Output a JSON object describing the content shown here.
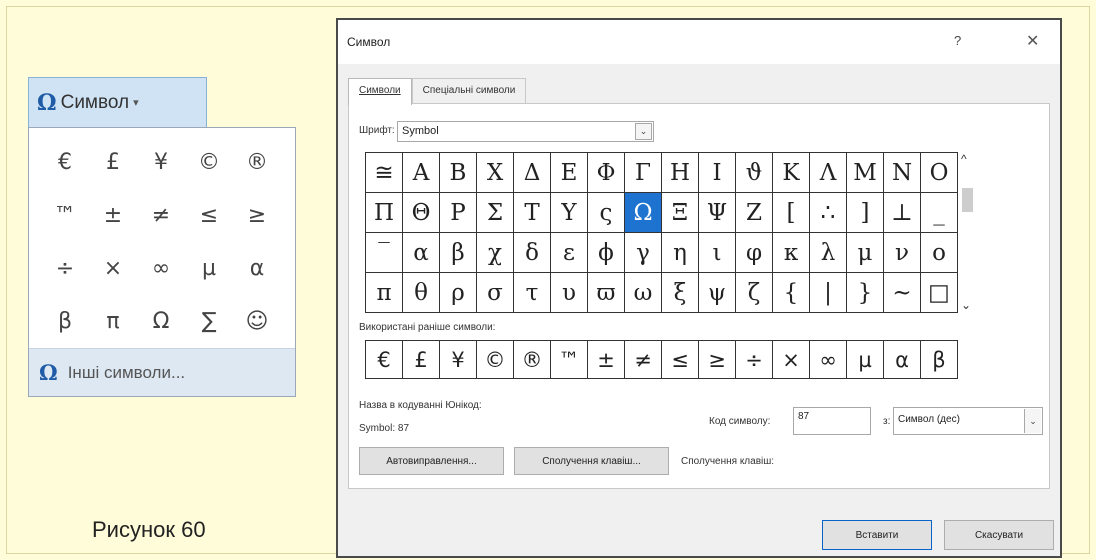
{
  "caption": "Рисунок 60",
  "ribbon": {
    "symbol_button_icon": "Ω",
    "symbol_button_label": "Символ",
    "symbol_button_caret": "▾",
    "quick_symbols": [
      "€",
      "£",
      "¥",
      "©",
      "®",
      "™",
      "±",
      "≠",
      "≤",
      "≥",
      "÷",
      "×",
      "∞",
      "µ",
      "α",
      "β",
      "π",
      "Ω",
      "∑",
      "☺"
    ],
    "more_symbols_icon": "Ω",
    "more_symbols_label": "Інші символи..."
  },
  "dialog": {
    "title": "Символ",
    "help_label": "?",
    "close_label": "✕",
    "tabs": [
      {
        "label": "Символи",
        "active": true
      },
      {
        "label": "Спеціальні символи",
        "active": false
      }
    ],
    "font_label": "Шрифт:",
    "font_value": "Symbol",
    "font_dropdown_icon": "⌄",
    "char_grid": [
      "≅",
      "Α",
      "Β",
      "Χ",
      "Δ",
      "Ε",
      "Φ",
      "Γ",
      "Η",
      "Ι",
      "ϑ",
      "Κ",
      "Λ",
      "Μ",
      "Ν",
      "Ο",
      "Π",
      "Θ",
      "Ρ",
      "Σ",
      "Τ",
      "Υ",
      "ς",
      "Ω",
      "Ξ",
      "Ψ",
      "Ζ",
      "[",
      "∴",
      "]",
      "⊥",
      "_",
      "‾",
      "α",
      "β",
      "χ",
      "δ",
      "ε",
      "ϕ",
      "γ",
      "η",
      "ι",
      "φ",
      "κ",
      "λ",
      "μ",
      "ν",
      "ο",
      "π",
      "θ",
      "ρ",
      "σ",
      "τ",
      "υ",
      "ϖ",
      "ω",
      "ξ",
      "ψ",
      "ζ",
      "{",
      "|",
      "}",
      "~",
      "□"
    ],
    "selected_index": 23,
    "scroll_up": "^",
    "scroll_down": "⌄",
    "recent_label": "Використані раніше символи:",
    "recent_symbols": [
      "€",
      "£",
      "¥",
      "©",
      "®",
      "™",
      "±",
      "≠",
      "≤",
      "≥",
      "÷",
      "×",
      "∞",
      "µ",
      "α",
      "β"
    ],
    "unicode_name_label": "Назва в кодуванні Юнікод:",
    "unicode_name_value": "Symbol: 87",
    "char_code_label": "Код символу:",
    "char_code_value": "87",
    "from_label": "з:",
    "from_value": "Символ (дес)",
    "from_dropdown_icon": "⌄",
    "autocorrect_button": "Автовиправлення...",
    "shortcut_key_button": "Сполучення клавіш...",
    "shortcut_key_label": "Сполучення клавіш:",
    "insert_button": "Вставити",
    "cancel_button": "Скасувати"
  }
}
